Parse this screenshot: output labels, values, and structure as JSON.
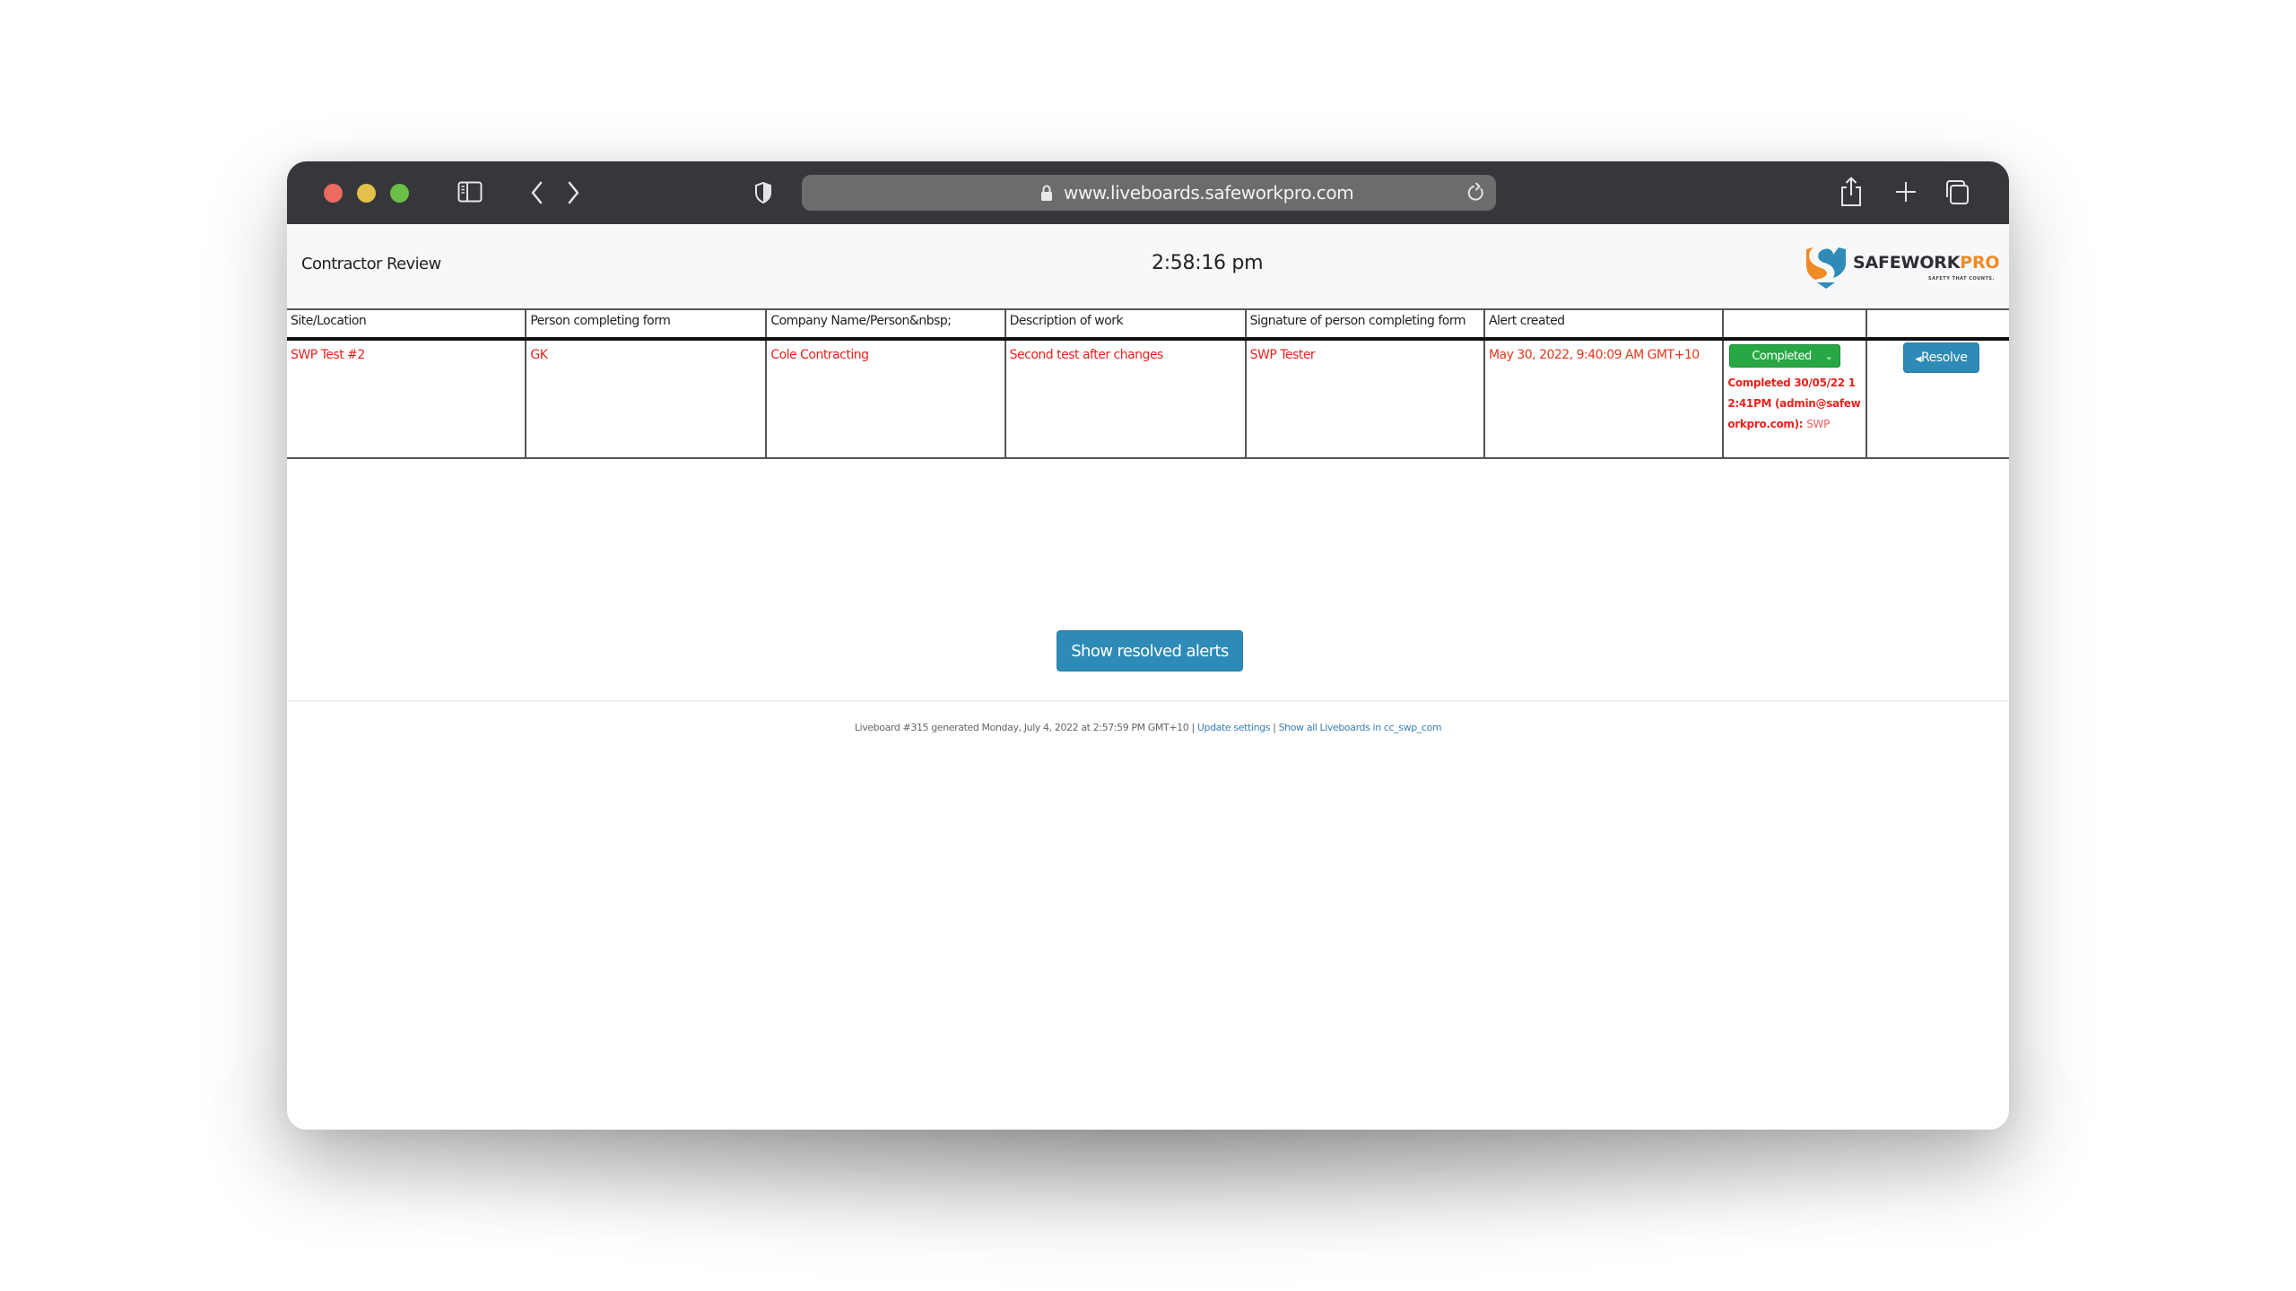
{
  "browser": {
    "url": "www.liveboards.safeworkpro.com",
    "icons": [
      "sidebar-icon",
      "back-icon",
      "forward-icon",
      "privacy-shield-icon",
      "lock-icon",
      "reload-icon",
      "share-icon",
      "new-tab-icon",
      "tabs-overview-icon"
    ]
  },
  "header": {
    "title": "Contractor Review",
    "clock": "2:58:16 pm",
    "logo": {
      "brand_main": "SAFEW",
      "brand_o": "O",
      "brand_rk": "RK",
      "brand_pro": "PRO",
      "tagline": "SAFETY THAT COUNTS."
    }
  },
  "table": {
    "columns": [
      "Site/Location",
      "Person completing form",
      "Company Name/Person&nbsp;",
      "Description of work",
      "Signature of person completing form",
      "Alert created",
      "",
      ""
    ],
    "rows": [
      {
        "site": "SWP Test #2",
        "person": "GK",
        "company": "Cole Contracting",
        "description": "Second test after changes",
        "signature": "SWP Tester",
        "alert_created": "May 30, 2022, 9:40:09 AM GMT+10",
        "status": "Completed",
        "status_note": "Completed 30/05/22 12:41PM (admin@safeworkpro.com):",
        "status_note_by": "SWP",
        "resolve_label": "Resolve"
      }
    ]
  },
  "show_resolved_label": "Show resolved alerts",
  "footer": {
    "text": "Liveboard #315 generated Monday, July 4, 2022 at 2:57:59 PM GMT+10 | ",
    "link1": "Update settings",
    "sep": " | ",
    "link2": "Show all Liveboards in cc_swp_com"
  },
  "colors": {
    "alert_text": "#e8231d",
    "completed_green": "#28a745",
    "button_blue": "#2e8bb7",
    "logo_orange": "#f08a24",
    "logo_blue": "#2e8bb7",
    "toolbar": "#36373b"
  }
}
